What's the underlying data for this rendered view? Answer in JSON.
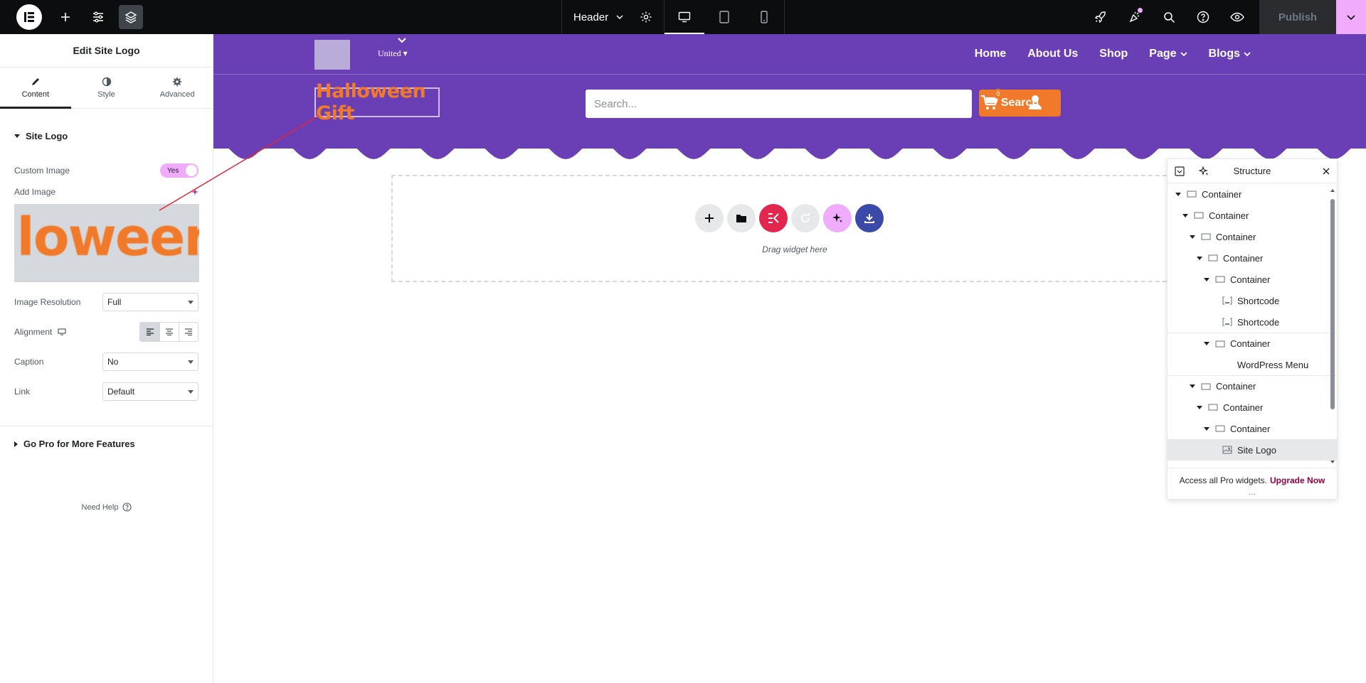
{
  "topbar": {
    "document_name": "Header",
    "publish_label": "Publish"
  },
  "panel": {
    "title": "Edit Site Logo",
    "tabs": [
      {
        "label": "Content"
      },
      {
        "label": "Style"
      },
      {
        "label": "Advanced"
      }
    ],
    "section_title": "Site Logo",
    "custom_image_label": "Custom Image",
    "custom_image_toggle": "Yes",
    "add_image_label": "Add Image",
    "image_preview_text": "lloween G",
    "image_resolution_label": "Image Resolution",
    "image_resolution_value": "Full",
    "alignment_label": "Alignment",
    "caption_label": "Caption",
    "caption_value": "No",
    "link_label": "Link",
    "link_value": "Default",
    "go_pro_label": "Go Pro for More Features",
    "need_help_label": "Need Help"
  },
  "site": {
    "language": "United",
    "menu": [
      {
        "label": "Home"
      },
      {
        "label": "About Us"
      },
      {
        "label": "Shop"
      },
      {
        "label": "Page"
      },
      {
        "label": "Blogs"
      }
    ],
    "brand_text": "Halloween Gift",
    "search_placeholder": "Search...",
    "search_button": "Search",
    "cart_count": "0",
    "drag_text": "Drag widget here"
  },
  "structure": {
    "title": "Structure",
    "items": [
      {
        "label": "Container"
      },
      {
        "label": "Container"
      },
      {
        "label": "Container"
      },
      {
        "label": "Container"
      },
      {
        "label": "Container"
      },
      {
        "label": "Shortcode"
      },
      {
        "label": "Shortcode"
      },
      {
        "label": "Container"
      },
      {
        "label": "WordPress Menu"
      },
      {
        "label": "Container"
      },
      {
        "label": "Container"
      },
      {
        "label": "Container"
      },
      {
        "label": "Site Logo"
      }
    ],
    "footer_text": "Access all Pro widgets.",
    "footer_link": "Upgrade Now"
  },
  "colors": {
    "accent_pink": "#f0abfc",
    "site_purple": "#6a3fb6",
    "site_orange": "#f07a2a",
    "topbar_bg": "#0c0d0e",
    "upgrade_link": "#93003f"
  },
  "icons": [
    "elementor-logo-icon",
    "plus-icon",
    "sliders-icon",
    "layers-icon",
    "chevron-down-icon",
    "gear-icon",
    "desktop-icon",
    "tablet-icon",
    "mobile-icon",
    "rocket-icon",
    "notifications-icon",
    "search-icon",
    "help-icon",
    "eye-icon",
    "pencil-icon",
    "contrast-icon",
    "cog-icon",
    "heart-icon",
    "cart-icon",
    "user-icon",
    "folder-icon",
    "download-icon",
    "sparkle-icon",
    "close-icon"
  ]
}
